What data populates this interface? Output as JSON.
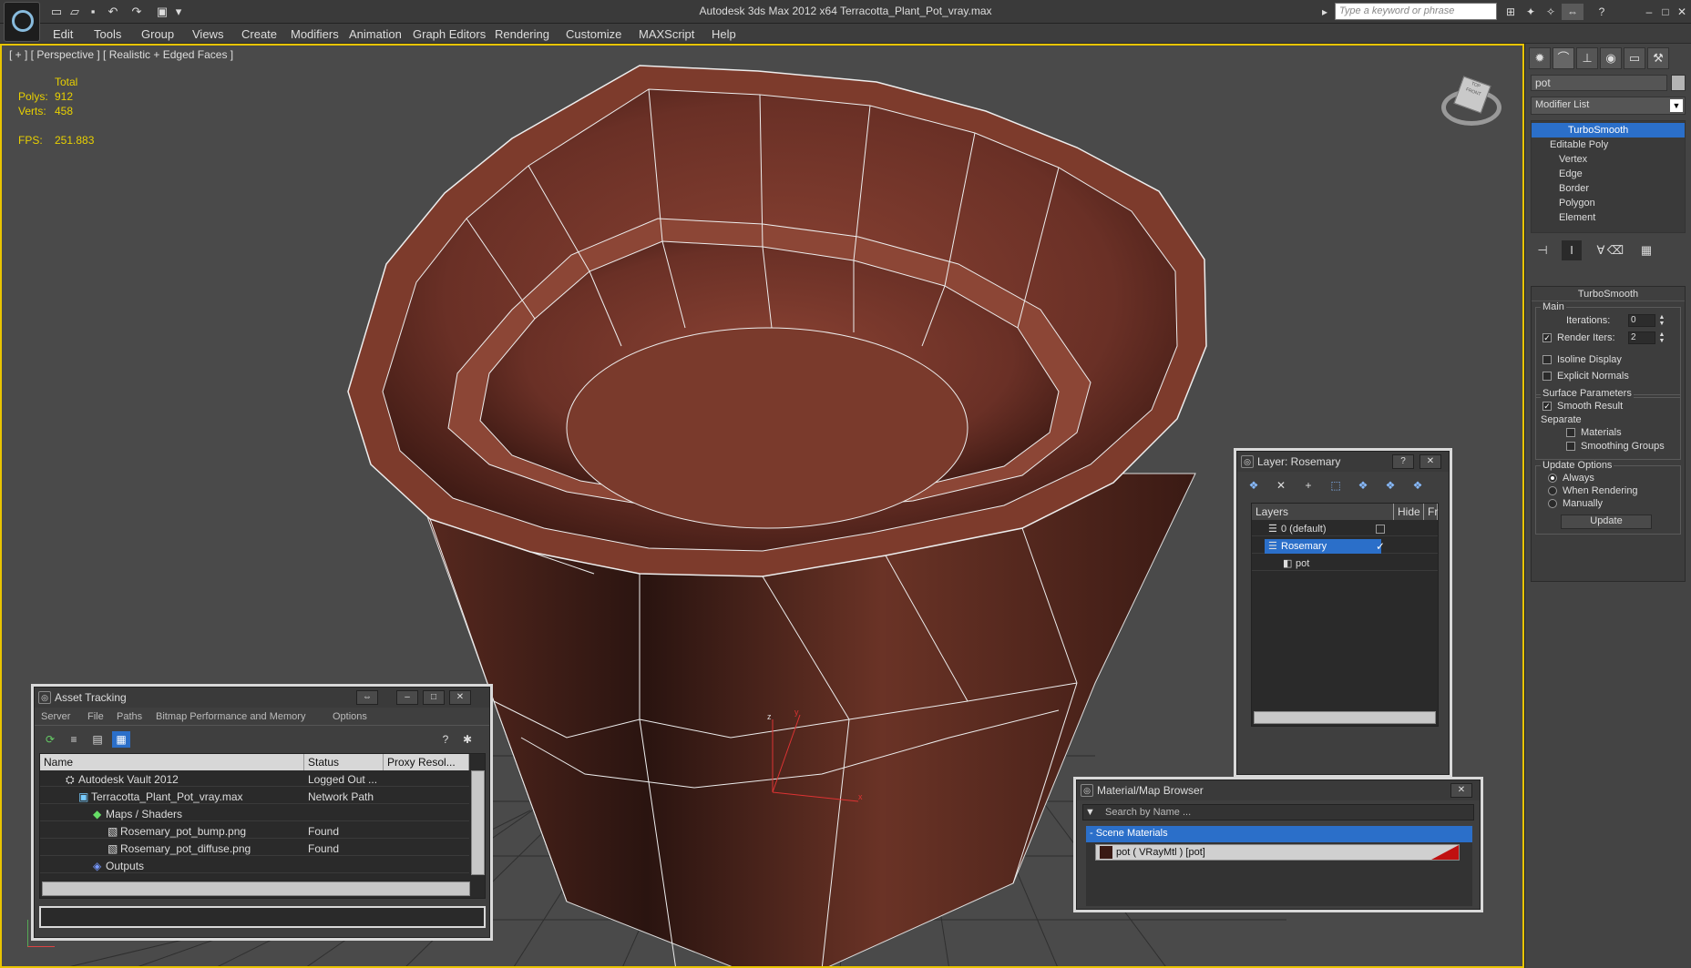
{
  "window": {
    "title": "Autodesk 3ds Max  2012 x64     Terracotta_Plant_Pot_vray.max",
    "search_placeholder": "Type a keyword or phrase"
  },
  "menu": [
    "Edit",
    "Tools",
    "Group",
    "Views",
    "Create",
    "Modifiers",
    "Animation",
    "Graph Editors",
    "Rendering",
    "Customize",
    "MAXScript",
    "Help"
  ],
  "viewport": {
    "label": "[ + ] [ Perspective ] [ Realistic + Edged Faces ]",
    "stats": {
      "total_label": "Total",
      "polys_label": "Polys:",
      "polys": "912",
      "verts_label": "Verts:",
      "verts": "458",
      "fps_label": "FPS:",
      "fps": "251.883"
    },
    "viewcube": {
      "top": "TOP",
      "front": "FRONT"
    },
    "axis": {
      "x": "x",
      "y": "y",
      "z": "z"
    }
  },
  "command_panel": {
    "object_name": "pot",
    "modifier_list": "Modifier List",
    "stack": [
      "TurboSmooth",
      "Editable Poly",
      "Vertex",
      "Edge",
      "Border",
      "Polygon",
      "Element"
    ],
    "turbosmooth": {
      "title": "TurboSmooth",
      "main": "Main",
      "iterations_label": "Iterations:",
      "iterations": "0",
      "render_iters_label": "Render Iters:",
      "render_iters": "2",
      "isoline": "Isoline Display",
      "explicit_normals": "Explicit Normals",
      "surface_params": "Surface Parameters",
      "smooth_result": "Smooth Result",
      "separate": "Separate",
      "materials": "Materials",
      "smoothing_groups": "Smoothing Groups",
      "update_options": "Update Options",
      "always": "Always",
      "when_rendering": "When Rendering",
      "manually": "Manually",
      "update": "Update"
    }
  },
  "asset_tracking": {
    "title": "Asset Tracking",
    "menu": [
      "Server",
      "File",
      "Paths",
      "Bitmap Performance and Memory",
      "Options"
    ],
    "columns": [
      "Name",
      "Status",
      "Proxy Resol..."
    ],
    "rows": [
      {
        "name": "Autodesk Vault 2012",
        "status": "Logged Out ..."
      },
      {
        "name": "Terracotta_Plant_Pot_vray.max",
        "status": "Network Path"
      },
      {
        "name": "Maps / Shaders",
        "status": ""
      },
      {
        "name": "Rosemary_pot_bump.png",
        "status": "Found"
      },
      {
        "name": "Rosemary_pot_diffuse.png",
        "status": "Found"
      },
      {
        "name": "Outputs",
        "status": ""
      }
    ]
  },
  "layer_dialog": {
    "title": "Layer: Rosemary",
    "columns": [
      "Layers",
      "Hide",
      "Fr"
    ],
    "rows": [
      "0 (default)",
      "Rosemary",
      "pot"
    ]
  },
  "material_browser": {
    "title": "Material/Map Browser",
    "search_placeholder": "Search by Name ...",
    "group": "- Scene Materials",
    "item": "pot  ( VRayMtl )  [pot]"
  }
}
